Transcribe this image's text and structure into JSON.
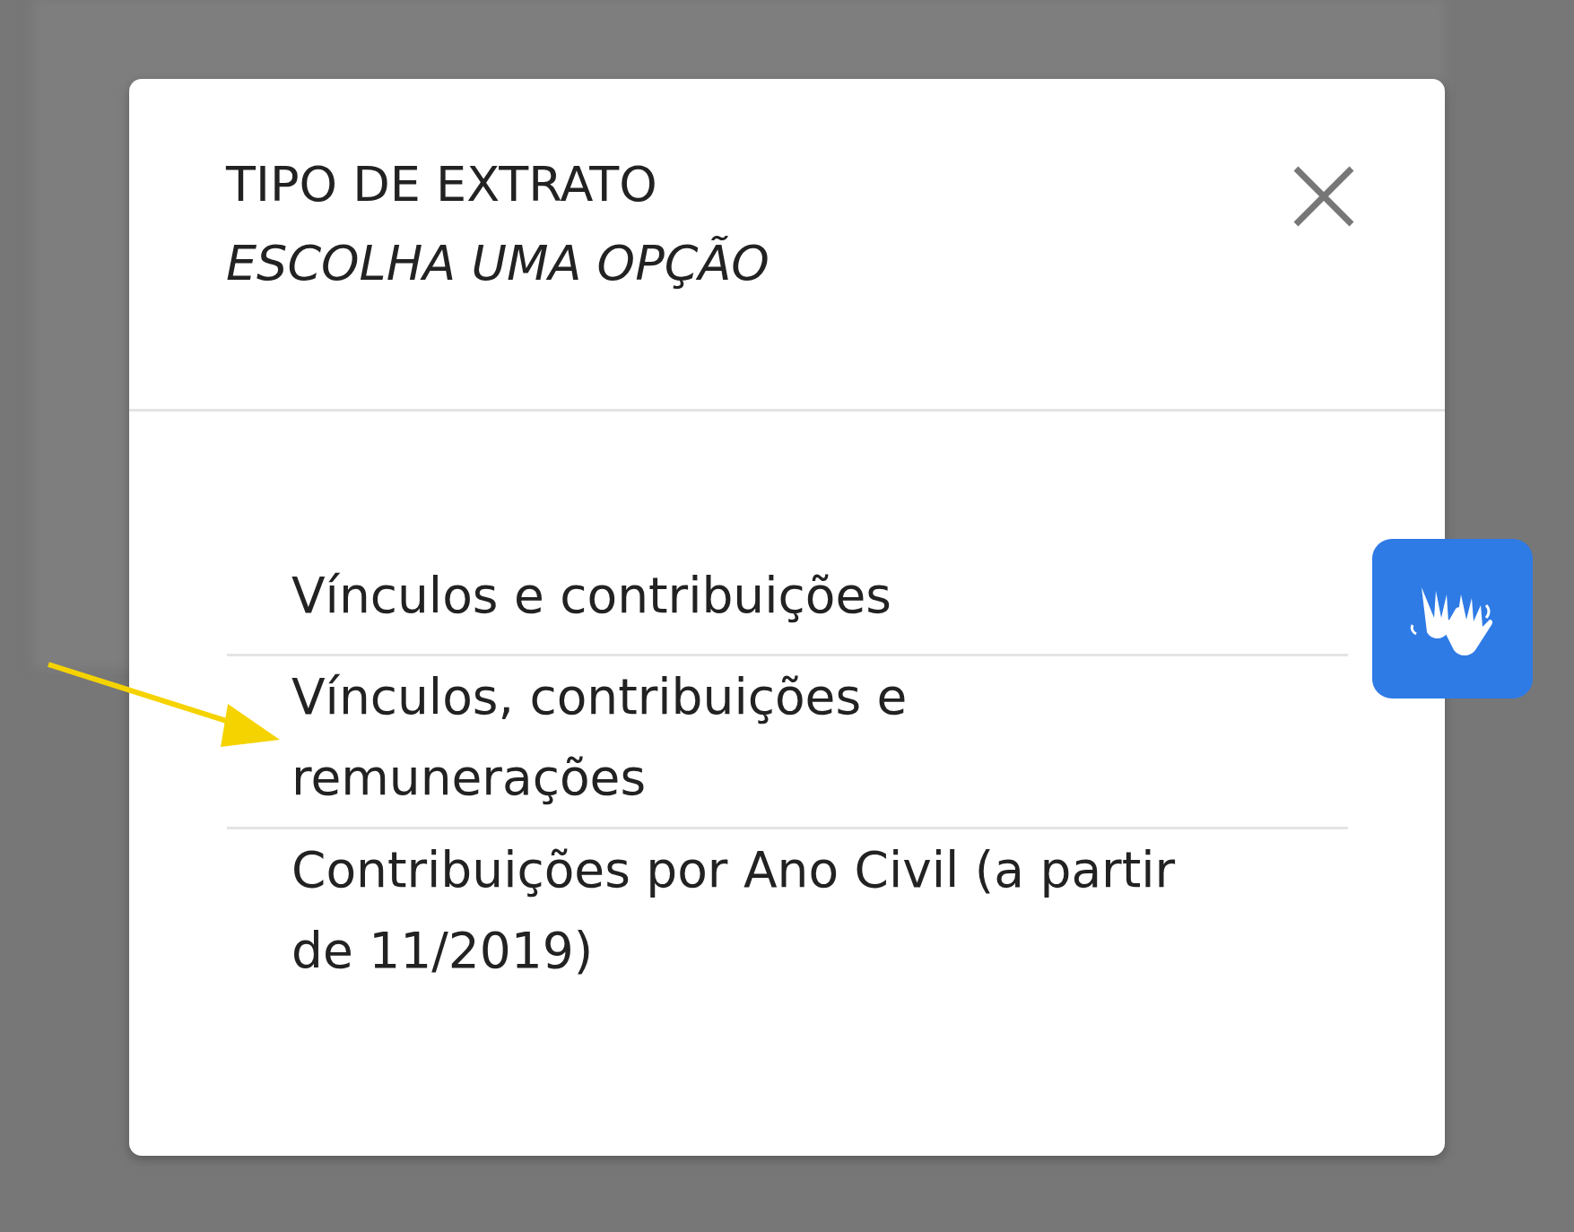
{
  "dialog": {
    "title": "TIPO DE EXTRATO",
    "subtitle": "ESCOLHA UMA OPÇÃO",
    "options": [
      {
        "label": "Vínculos e contribuições"
      },
      {
        "label": "Vínculos, contribuições e remunerações"
      },
      {
        "label": "Contribuições por Ano Civil (a partir de 11/2019)"
      }
    ]
  }
}
